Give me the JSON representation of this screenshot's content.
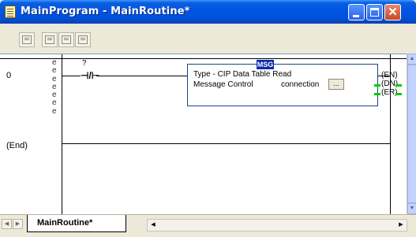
{
  "window": {
    "title": "MainProgram - MainRoutine*",
    "minimize_label": "_",
    "maximize_label": "□",
    "close_label": "✕"
  },
  "toolbar": {
    "buttons": [
      "go-to-icon",
      "add-rung-icon",
      "remove-rung-icon",
      "export-icon"
    ]
  },
  "ladder": {
    "rung_number": "0",
    "end_label": "(End)",
    "e_markers": [
      "e",
      "e",
      "e",
      "e",
      "e",
      "e",
      "e"
    ],
    "contact": {
      "tag": "?",
      "symbol": "⊣/⊢"
    },
    "msg": {
      "instruction": "MSG",
      "type_line": "Type - CIP Data Table Read",
      "control_label": "Message Control",
      "control_value": "connection",
      "ellipsis": "...",
      "outputs": [
        "EN",
        "DN",
        "ER"
      ]
    }
  },
  "tabs": {
    "active": "MainRoutine*"
  },
  "colors": {
    "msg_tag_bg": "#0b2aa8",
    "output_energized": "#00cc00",
    "title_bar": "#0054e3"
  }
}
